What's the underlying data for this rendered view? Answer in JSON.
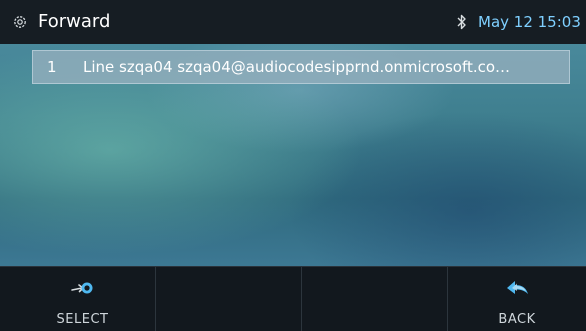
{
  "status_bar": {
    "title": "Forward",
    "settings_icon": "gear-icon",
    "bluetooth_icon": "bluetooth-icon",
    "datetime": "May 12 15:03",
    "datetime_color": "#7fd0ff"
  },
  "list": {
    "items": [
      {
        "index": "1",
        "text": "Line  szqa04 szqa04@audiocodesipprnd.onmicrosoft.co…"
      }
    ]
  },
  "softkeys": [
    {
      "label": "SELECT",
      "icon": "forward-select-icon"
    },
    {
      "label": "",
      "icon": ""
    },
    {
      "label": "",
      "icon": ""
    },
    {
      "label": "BACK",
      "icon": "back-arrow-icon"
    }
  ],
  "colors": {
    "accent": "#7fd0ff",
    "softkey_icon": "#4fb8f0"
  }
}
